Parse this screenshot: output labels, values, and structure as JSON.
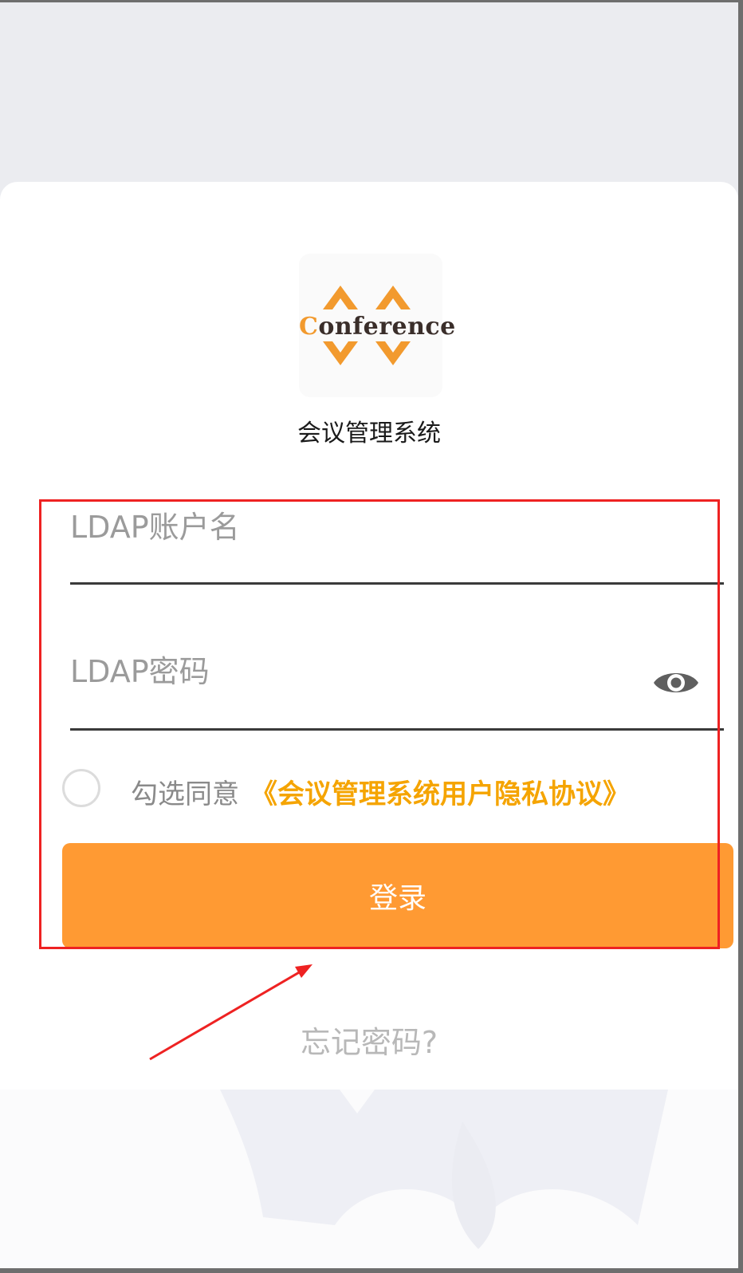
{
  "logo": {
    "wordmark_prefix": "C",
    "wordmark_rest": "onference"
  },
  "app": {
    "title": "会议管理系统"
  },
  "login_form": {
    "username_placeholder": "LDAP账户名",
    "password_placeholder": "LDAP密码",
    "password_toggle_icon": "eye-icon",
    "agree_prefix": "勾选同意",
    "agree_link": "《会议管理系统用户隐私协议》",
    "submit_label": "登录",
    "forgot_password": "忘记密码?"
  },
  "colors": {
    "accent": "#ff9a33",
    "link": "#f5a400",
    "highlight": "#ee2222"
  }
}
